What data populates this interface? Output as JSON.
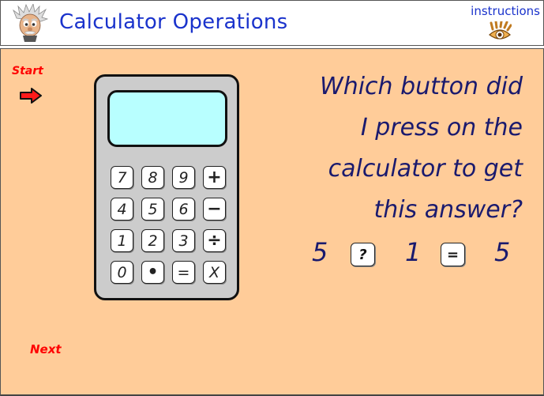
{
  "header": {
    "title": "Calculator Operations",
    "logo_icon": "einstein-cartoon-icon",
    "instructions_label": "instructions",
    "instructions_icon": "eye-icon"
  },
  "nav": {
    "start_label": "Start",
    "start_icon": "right-arrow-icon",
    "next_label": "Next"
  },
  "calculator": {
    "display_value": "",
    "keys": [
      "7",
      "8",
      "9",
      "+",
      "4",
      "5",
      "6",
      "−",
      "1",
      "2",
      "3",
      "÷",
      "0",
      "•",
      "=",
      "X"
    ]
  },
  "question": {
    "text": "Which button did I press on the calculator to get this answer?",
    "lines": [
      "Which button did",
      "I press on the",
      "calculator to get",
      "this answer?"
    ]
  },
  "equation": {
    "operand1": "5",
    "operator": "?",
    "operand2": "1",
    "equals": "=",
    "result": "5"
  },
  "colors": {
    "title": "#1a33cc",
    "stage_bg": "#ffcc99",
    "question_text": "#1a1a6e",
    "nav_red": "#ff0000",
    "calc_body": "#cccccc",
    "calc_display": "#b8ffff"
  }
}
